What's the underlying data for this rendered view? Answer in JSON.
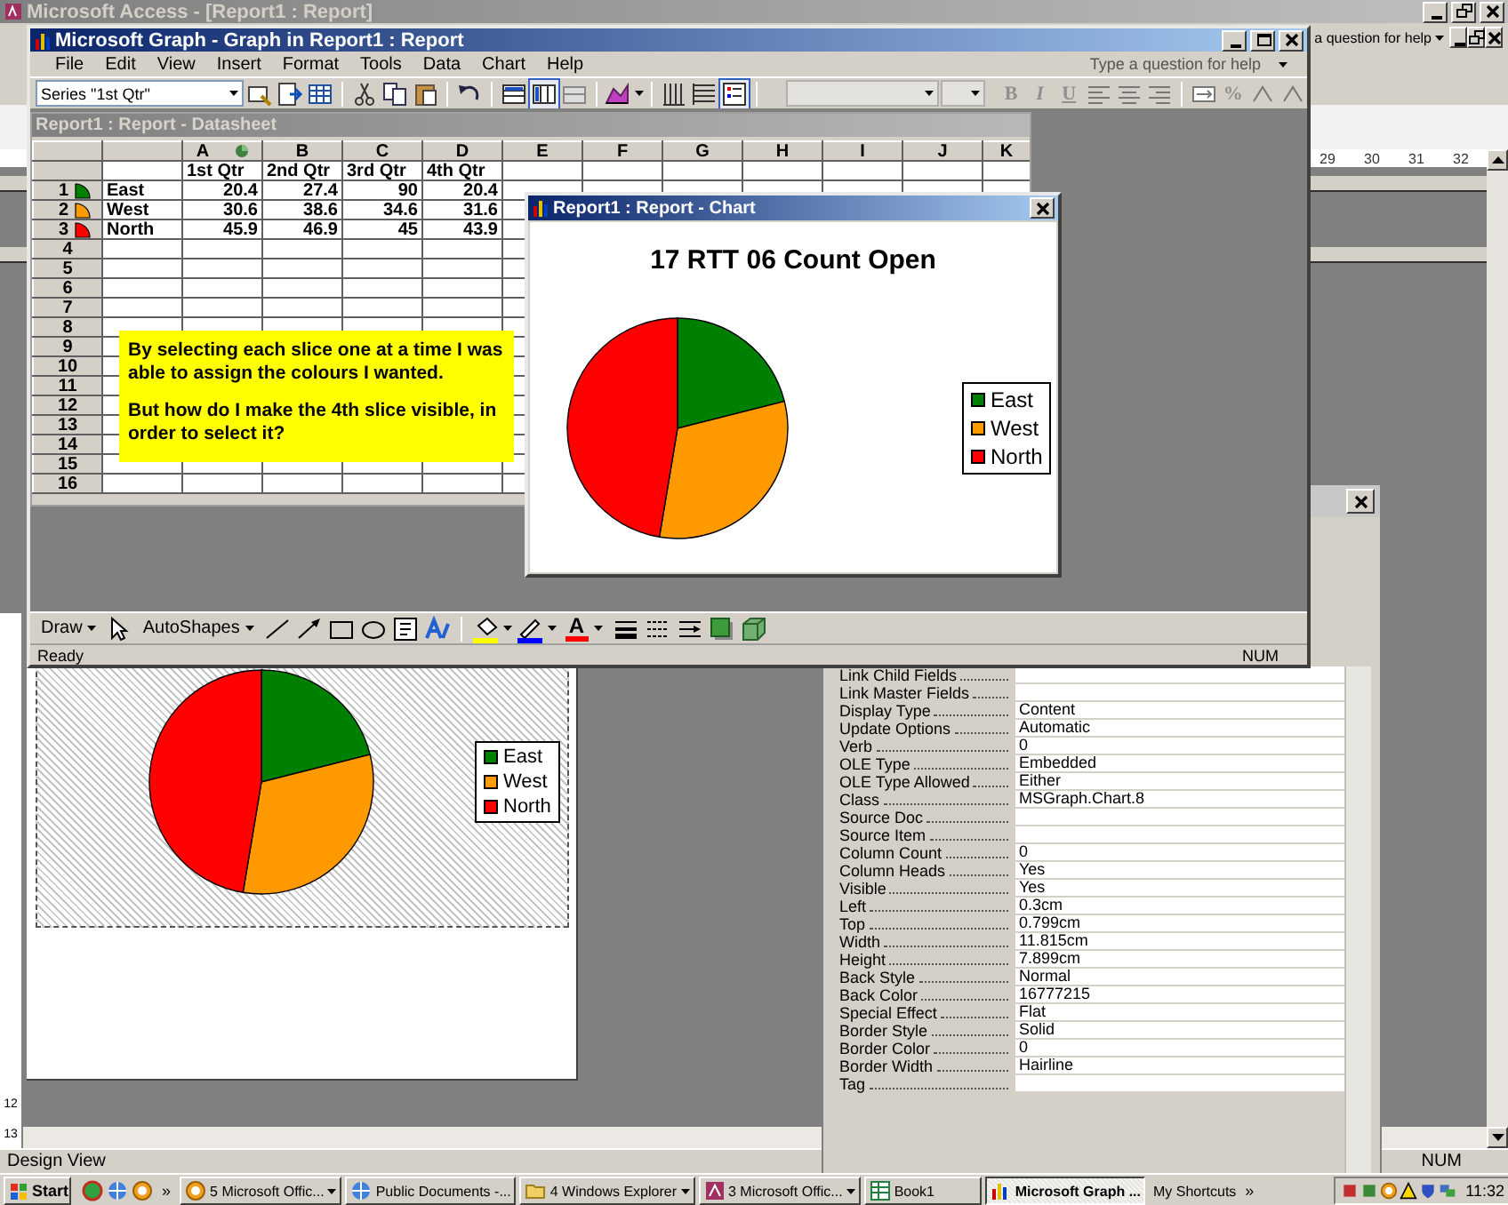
{
  "access_window": {
    "title": "Microsoft Access - [Report1 : Report]",
    "help_field": "a question for help",
    "ruler_labels": [
      "29",
      "30",
      "31",
      "32"
    ],
    "vertical_ruler_labels": [
      "12",
      "13"
    ],
    "status_text": "Design View",
    "status_indicator": "NUM"
  },
  "graph_window": {
    "title": "Microsoft Graph - Graph in Report1 : Report",
    "menu": [
      "File",
      "Edit",
      "View",
      "Insert",
      "Format",
      "Tools",
      "Data",
      "Chart",
      "Help"
    ],
    "help_field": "Type a question for help",
    "chart_objects_dropdown": "Series \"1st Qtr\"",
    "format_buttons": [
      "B",
      "I",
      "U",
      "%"
    ],
    "drawing_toolbar": {
      "draw": "Draw",
      "autoshapes": "AutoShapes",
      "font_color": "A"
    },
    "status_text": "Ready",
    "status_indicator": "NUM"
  },
  "datasheet": {
    "title": "Report1 : Report - Datasheet",
    "columns": [
      "A",
      "B",
      "C",
      "D",
      "E",
      "F",
      "G",
      "H",
      "I",
      "J",
      "K"
    ],
    "series_labels": [
      "1st Qtr",
      "2nd Qtr",
      "3rd Qtr",
      "4th Qtr"
    ],
    "rows": [
      {
        "number": "1",
        "name": "East",
        "color": "#008000",
        "values": [
          "20.4",
          "27.4",
          "90",
          "20.4"
        ]
      },
      {
        "number": "2",
        "name": "West",
        "color": "#ff9900",
        "values": [
          "30.6",
          "38.6",
          "34.6",
          "31.6"
        ]
      },
      {
        "number": "3",
        "name": "North",
        "color": "#ff0000",
        "values": [
          "45.9",
          "46.9",
          "45",
          "43.9"
        ]
      }
    ],
    "empty_rows": [
      "4",
      "5",
      "6",
      "7",
      "8",
      "9",
      "10",
      "11",
      "12",
      "13",
      "14",
      "15",
      "16"
    ]
  },
  "note": {
    "paragraphs": [
      "By selecting each slice one at a time I was able to assign the colours I wanted.",
      "But how do I make the 4th slice visible, in order to select it?"
    ]
  },
  "chart_window": {
    "title": "Report1 : Report - Chart",
    "chart_title": "17 RTT 06 Count Open",
    "legend": [
      {
        "label": "East",
        "color": "#008000"
      },
      {
        "label": "West",
        "color": "#ff9900"
      },
      {
        "label": "North",
        "color": "#ff0000"
      }
    ]
  },
  "report_preview": {
    "legend": [
      {
        "label": "East",
        "color": "#008000"
      },
      {
        "label": "West",
        "color": "#ff9900"
      },
      {
        "label": "North",
        "color": "#ff0000"
      }
    ]
  },
  "property_sheet": {
    "rows": [
      {
        "label": "Link Child Fields",
        "value": ""
      },
      {
        "label": "Link Master Fields",
        "value": ""
      },
      {
        "label": "Display Type",
        "value": "Content"
      },
      {
        "label": "Update Options",
        "value": "Automatic"
      },
      {
        "label": "Verb",
        "value": "0"
      },
      {
        "label": "OLE Type",
        "value": "Embedded"
      },
      {
        "label": "OLE Type Allowed",
        "value": "Either"
      },
      {
        "label": "Class",
        "value": "MSGraph.Chart.8"
      },
      {
        "label": "Source Doc",
        "value": ""
      },
      {
        "label": "Source Item",
        "value": ""
      },
      {
        "label": "Column Count",
        "value": "0"
      },
      {
        "label": "Column Heads",
        "value": "Yes"
      },
      {
        "label": "Visible",
        "value": "Yes"
      },
      {
        "label": "Left",
        "value": "0.3cm"
      },
      {
        "label": "Top",
        "value": "0.799cm"
      },
      {
        "label": "Width",
        "value": "11.815cm"
      },
      {
        "label": "Height",
        "value": "7.899cm"
      },
      {
        "label": "Back Style",
        "value": "Normal"
      },
      {
        "label": "Back Color",
        "value": "16777215"
      },
      {
        "label": "Special Effect",
        "value": "Flat"
      },
      {
        "label": "Border Style",
        "value": "Solid"
      },
      {
        "label": "Border Color",
        "value": "0"
      },
      {
        "label": "Border Width",
        "value": "Hairline"
      },
      {
        "label": "Tag",
        "value": ""
      }
    ]
  },
  "taskbar": {
    "start": "Start",
    "quick_launch_overflow": "»",
    "items": [
      {
        "label": "5 Microsoft Offic...",
        "kind": "app",
        "grouped": true,
        "selected": false
      },
      {
        "label": "Public Documents -...",
        "kind": "browser",
        "grouped": false,
        "selected": false
      },
      {
        "label": "4 Windows Explorer",
        "kind": "folder",
        "grouped": true,
        "selected": false
      },
      {
        "label": "3 Microsoft Offic...",
        "kind": "access",
        "grouped": true,
        "selected": false
      },
      {
        "label": "Book1",
        "kind": "spreadsheet",
        "grouped": false,
        "selected": false
      },
      {
        "label": "Microsoft Graph ...",
        "kind": "chart",
        "grouped": false,
        "selected": true
      }
    ],
    "toolbar_label": "My Shortcuts",
    "toolbar_overflow": "»",
    "clock": "11:32"
  }
}
